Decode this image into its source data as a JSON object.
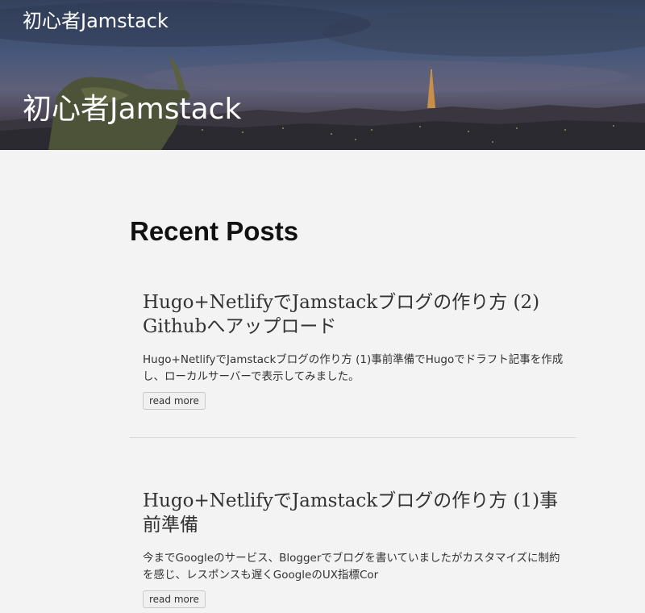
{
  "header": {
    "site_name": "初心者Jamstack",
    "hero_title": "初心者Jamstack"
  },
  "main": {
    "section_title": "Recent Posts",
    "posts": [
      {
        "title": "Hugo+NetlifyでJamstackブログの作り方 (2) Githubへアップロード",
        "summary": "Hugo+NetlifyでJamstackブログの作り方 (1)事前準備でHugoでドラフト記事を作成し、ローカルサーバーで表示してみました。",
        "read_more_label": "read more"
      },
      {
        "title": "Hugo+NetlifyでJamstackブログの作り方 (1)事前準備",
        "summary": "今までGoogleのサービス、Bloggerでブログを書いていましたがカスタマイズに制約を感じ、レスポンスも遅くGoogleのUX指標Cor",
        "read_more_label": "read more"
      }
    ]
  }
}
